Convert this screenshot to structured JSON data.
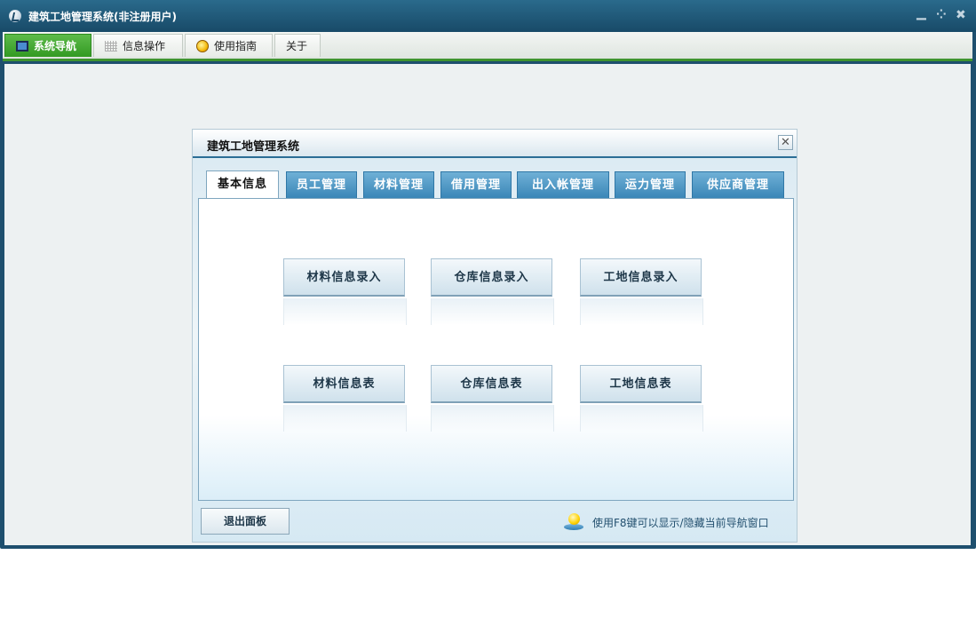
{
  "window": {
    "title": "建筑工地管理系统(非注册用户)",
    "controls": {
      "minimize": "▁",
      "restore": "⁘",
      "close": "✖"
    }
  },
  "menu": {
    "tabs": [
      {
        "label": "系统导航",
        "icon": "monitor-icon",
        "active": true
      },
      {
        "label": "信息操作",
        "icon": "grid-icon",
        "active": false
      },
      {
        "label": "使用指南",
        "icon": "bulb-icon",
        "active": false
      },
      {
        "label": "关于",
        "icon": "",
        "active": false
      }
    ]
  },
  "dialog": {
    "title": "建筑工地管理系统",
    "close_glyph": "✕",
    "tabs": [
      {
        "label": "基本信息",
        "active": true
      },
      {
        "label": "员工管理",
        "active": false
      },
      {
        "label": "材料管理",
        "active": false
      },
      {
        "label": "借用管理",
        "active": false
      },
      {
        "label": "出入帐管理",
        "active": false
      },
      {
        "label": "运力管理",
        "active": false
      },
      {
        "label": "供应商管理",
        "active": false
      }
    ],
    "buttons": [
      "材料信息录入",
      "仓库信息录入",
      "工地信息录入",
      "材料信息表",
      "仓库信息表",
      "工地信息表"
    ],
    "exit_label": "退出面板",
    "hint": "使用F8键可以显示/隐藏当前导航窗口"
  },
  "colors": {
    "menu_accent": "#3f9430",
    "tab_blue": "#3a86b7",
    "title_bar": "#1e4f6e"
  }
}
